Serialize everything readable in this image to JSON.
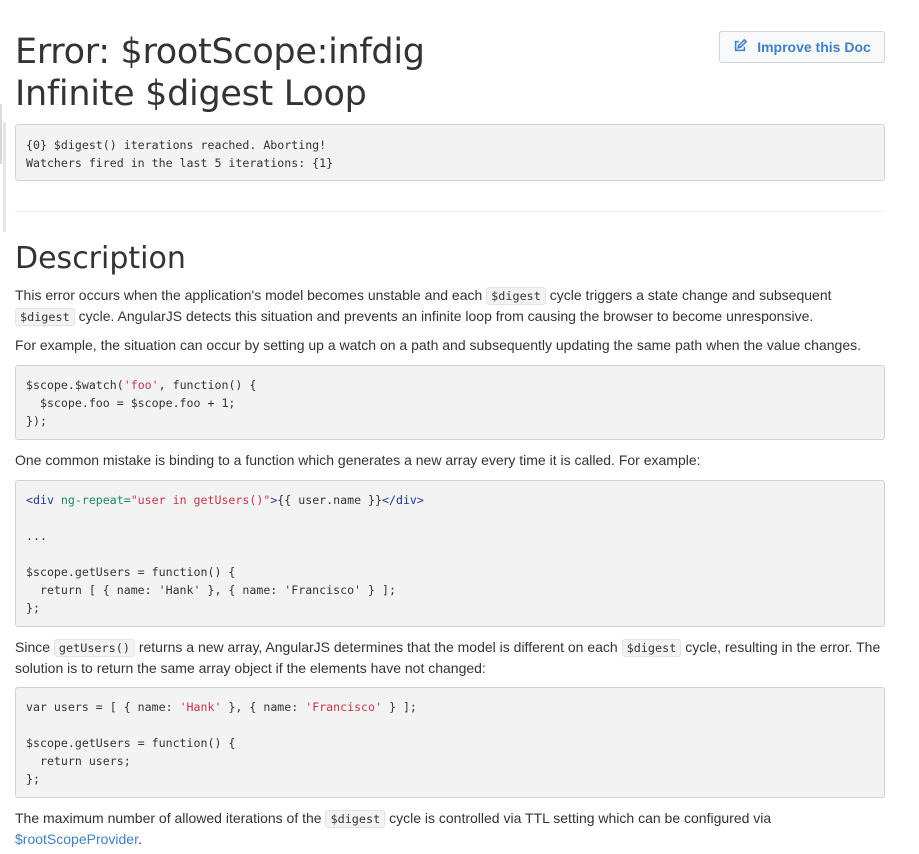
{
  "header": {
    "title_line1": "Error: $rootScope:infdig",
    "title_line2": "Infinite $digest Loop",
    "improve_button_label": "Improve this Doc",
    "improve_icon": "pencil-square-icon"
  },
  "error_message": {
    "line1": "{0} $digest() iterations reached. Aborting!",
    "line2": "Watchers fired in the last 5 iterations: {1}"
  },
  "description": {
    "heading": "Description",
    "p1": {
      "t1": "This error occurs when the application's model becomes unstable and each ",
      "c1": "$digest",
      "t2": " cycle triggers a state change and subsequent ",
      "c2": "$digest",
      "t3": " cycle. AngularJS detects this situation and prevents an infinite loop from causing the browser to become unresponsive."
    },
    "p2": "For example, the situation can occur by setting up a watch on a path and subsequently updating the same path when the value changes.",
    "code1": {
      "l1a": "$scope.$watch(",
      "l1s": "'foo'",
      "l1b": ", function() {",
      "l2": "  $scope.foo = $scope.foo + 1;",
      "l3": "});"
    },
    "p3": "One common mistake is binding to a function which generates a new array every time it is called. For example:",
    "code2": {
      "l1_tag_open": "<div",
      "l1_attr": " ng-repeat=",
      "l1_str": "\"user in getUsers()\"",
      "l1_gt": ">",
      "l1_text": "{{ user.name }}",
      "l1_tag_close": "</div>",
      "l3": "...",
      "l5": "$scope.getUsers = function() {",
      "l6": "  return [ { name: 'Hank' }, { name: 'Francisco' } ];",
      "l7": "};"
    },
    "p4": {
      "t1": "Since ",
      "c1": "getUsers()",
      "t2": " returns a new array, AngularJS determines that the model is different on each ",
      "c2": "$digest",
      "t3": " cycle, resulting in the error. The solution is to return the same array object if the elements have not changed:"
    },
    "code3": {
      "l1a": "var users = [ { name: ",
      "l1s1": "'Hank'",
      "l1b": " }, { name: ",
      "l1s2": "'Francisco'",
      "l1c": " } ];",
      "l3": "$scope.getUsers = function() {",
      "l4": "  return users;",
      "l5": "};"
    },
    "p5": {
      "t1": "The maximum number of allowed iterations of the ",
      "c1": "$digest",
      "t2": " cycle is controlled via TTL setting which can be configured via ",
      "link": "$rootScopeProvider",
      "t3": "."
    }
  },
  "colors": {
    "link": "#3f81c4",
    "code_bg": "#f3f3f3",
    "string": "#c4344e",
    "tag": "#1a3a8b",
    "attr": "#1b8c5a"
  }
}
